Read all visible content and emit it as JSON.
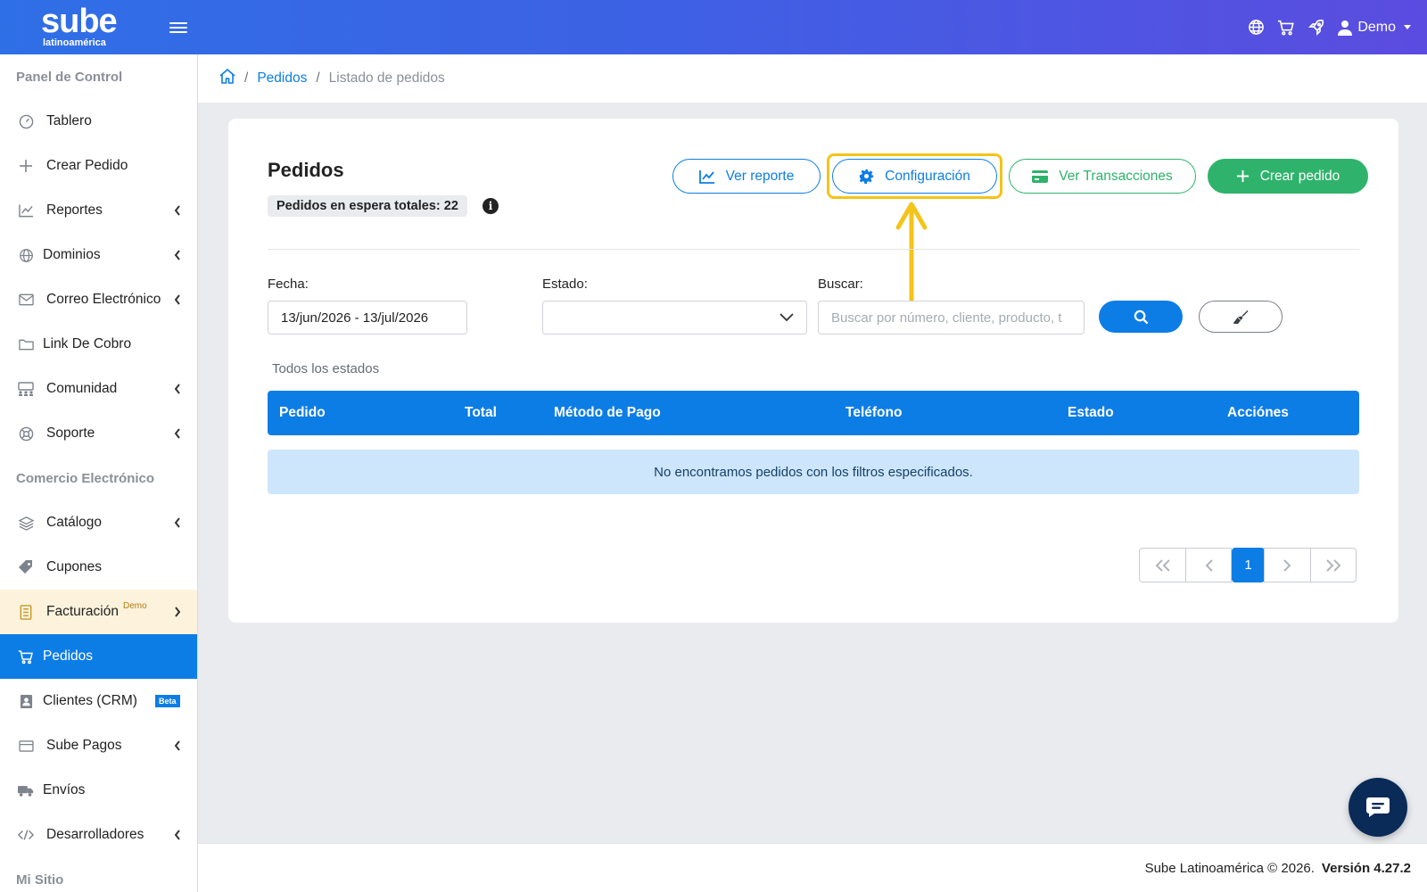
{
  "header": {
    "logo_main": "sube",
    "logo_sub": "latinoamérica",
    "user_label": "Demo"
  },
  "sidebar": {
    "section_panel": "Panel de Control",
    "section_commerce": "Comercio Electrónico",
    "section_site": "Mi Sitio",
    "items": [
      {
        "label": "Tablero"
      },
      {
        "label": "Crear Pedido"
      },
      {
        "label": "Reportes"
      },
      {
        "label": "Dominios"
      },
      {
        "label": "Correo Electrónico"
      },
      {
        "label": "Link De Cobro"
      },
      {
        "label": "Comunidad"
      },
      {
        "label": "Soporte"
      },
      {
        "label": "Catálogo"
      },
      {
        "label": "Cupones"
      },
      {
        "label": "Facturación",
        "sup": "Demo"
      },
      {
        "label": "Pedidos"
      },
      {
        "label": "Clientes (CRM)",
        "badge": "Beta"
      },
      {
        "label": "Sube Pagos"
      },
      {
        "label": "Envíos"
      },
      {
        "label": "Desarrolladores"
      }
    ]
  },
  "breadcrumb": {
    "link": "Pedidos",
    "current": "Listado de pedidos",
    "separator": "/"
  },
  "main": {
    "title": "Pedidos",
    "pending_label": "Pedidos en espera totales: 22",
    "info_glyph": "i",
    "buttons": {
      "report": "Ver reporte",
      "config": "Configuración",
      "transactions": "Ver Transacciones",
      "create": "Crear pedido"
    },
    "filters": {
      "date_label": "Fecha:",
      "date_value": "13/jun/2026 - 13/jul/2026",
      "status_label": "Estado:",
      "status_value": "",
      "search_label": "Buscar:",
      "search_placeholder": "Buscar por número, cliente, producto, t"
    },
    "all_states": "Todos los estados",
    "table_headers": [
      "Pedido",
      "Total",
      "Método de Pago",
      "Teléfono",
      "Estado",
      "Acciónes"
    ],
    "empty_message": "No encontramos pedidos con los filtros especificados.",
    "pagination": {
      "current_page": "1"
    }
  },
  "footer": {
    "copyright": "Sube Latinoamérica © 2026.",
    "version": "Versión 4.27.2"
  },
  "colors": {
    "primary": "#0d7de6",
    "success": "#2fb36c",
    "highlight": "#f3c419",
    "header_start": "#2f6fe6",
    "header_end": "#5b4ce0"
  }
}
